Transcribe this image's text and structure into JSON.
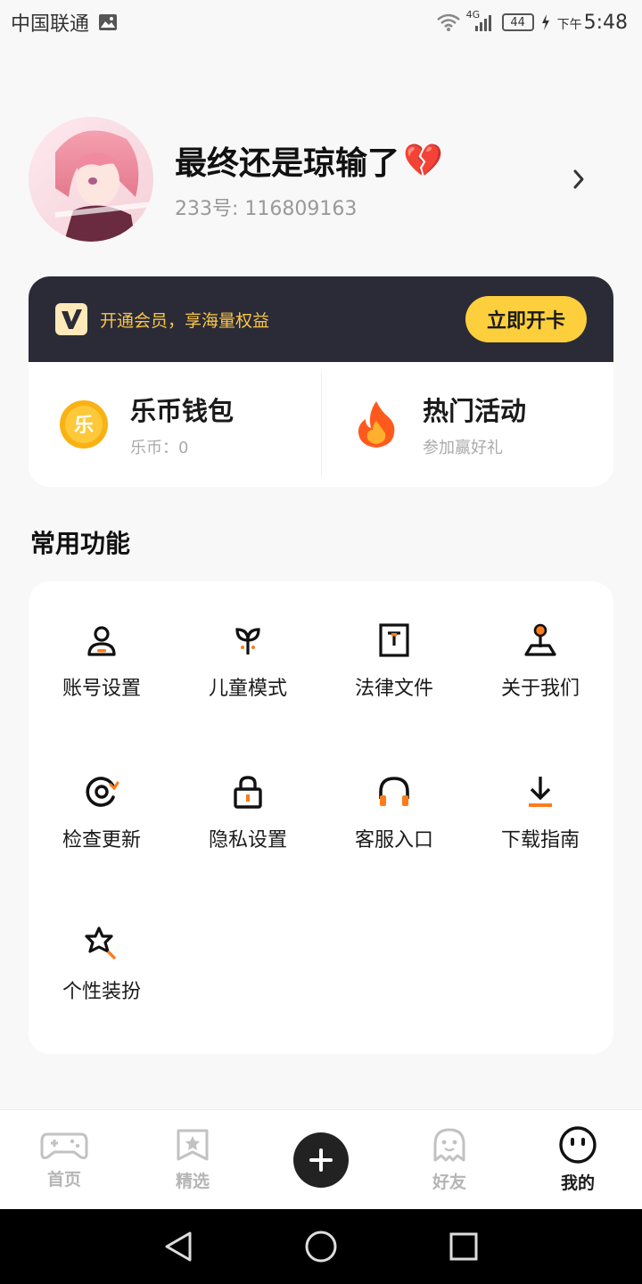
{
  "status_bar": {
    "carrier": "中国联通",
    "network": "4G",
    "battery": "44",
    "time_prefix": "下午",
    "time": "5:48"
  },
  "profile": {
    "nickname": "最终还是琼输了",
    "nickname_emoji": "💔",
    "user_id": "233号: 116809163"
  },
  "membership": {
    "promo_text": "开通会员，享海量权益",
    "button_label": "立即开卡",
    "logo_letter": "V"
  },
  "wallet": {
    "title": "乐币钱包",
    "sub": "乐币：0",
    "coin_char": "乐"
  },
  "activity": {
    "title": "热门活动",
    "sub": "参加赢好礼"
  },
  "common_functions": {
    "title": "常用功能",
    "items": [
      {
        "label": "账号设置",
        "icon": "account-icon"
      },
      {
        "label": "儿童模式",
        "icon": "sprout-icon"
      },
      {
        "label": "法律文件",
        "icon": "legal-doc-icon"
      },
      {
        "label": "关于我们",
        "icon": "joystick-icon"
      },
      {
        "label": "检查更新",
        "icon": "refresh-icon"
      },
      {
        "label": "隐私设置",
        "icon": "lock-icon"
      },
      {
        "label": "客服入口",
        "icon": "headphones-icon"
      },
      {
        "label": "下载指南",
        "icon": "download-icon"
      },
      {
        "label": "个性装扮",
        "icon": "magic-star-icon"
      }
    ]
  },
  "bottom_nav": {
    "items": [
      {
        "label": "首页",
        "icon": "gamepad-icon"
      },
      {
        "label": "精选",
        "icon": "star-bookmark-icon"
      },
      {
        "label": "",
        "icon": "plus-icon"
      },
      {
        "label": "好友",
        "icon": "ghost-icon"
      },
      {
        "label": "我的",
        "icon": "smile-face-icon"
      }
    ],
    "active_index": 4
  },
  "colors": {
    "accent": "#ff7b1c",
    "vip_bg": "#2b2b38",
    "vip_gold": "#fdcf3c",
    "background": "#f8f8f8"
  }
}
